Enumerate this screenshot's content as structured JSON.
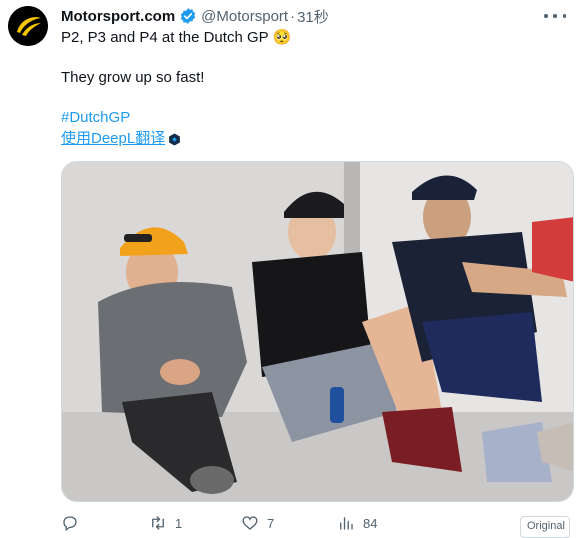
{
  "post": {
    "author_name": "Motorsport.com",
    "handle": "@Motorsport",
    "separator": "·",
    "time": "31秒",
    "line1": "P2, P3 and P4 at the Dutch GP 🥺",
    "line2": "They grow up so fast!",
    "hashtag": "#DutchGP",
    "translate_label": "使用DeepL翻译"
  },
  "actions": {
    "reply_count": "",
    "repost_count": "1",
    "like_count": "7",
    "views_count": "84"
  },
  "badge": {
    "original_label": "Original"
  },
  "colors": {
    "link": "#1d9bf0",
    "verified": "#1d9bf0",
    "muted": "#536471",
    "brand_yellow": "#f7c600"
  },
  "icons": [
    "motorsport-logo",
    "verified-badge-icon",
    "more-icon",
    "translate-icon",
    "reply-icon",
    "repost-icon",
    "like-icon",
    "views-icon"
  ]
}
